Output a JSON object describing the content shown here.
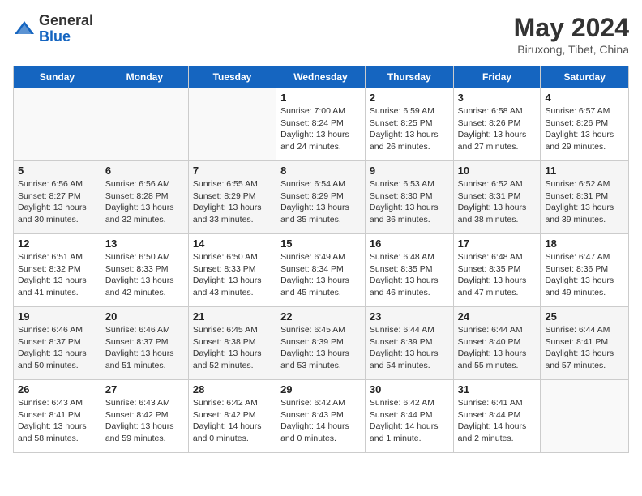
{
  "header": {
    "logo_general": "General",
    "logo_blue": "Blue",
    "month": "May 2024",
    "location": "Biruxong, Tibet, China"
  },
  "weekdays": [
    "Sunday",
    "Monday",
    "Tuesday",
    "Wednesday",
    "Thursday",
    "Friday",
    "Saturday"
  ],
  "weeks": [
    [
      {
        "day": "",
        "info": ""
      },
      {
        "day": "",
        "info": ""
      },
      {
        "day": "",
        "info": ""
      },
      {
        "day": "1",
        "info": "Sunrise: 7:00 AM\nSunset: 8:24 PM\nDaylight: 13 hours\nand 24 minutes."
      },
      {
        "day": "2",
        "info": "Sunrise: 6:59 AM\nSunset: 8:25 PM\nDaylight: 13 hours\nand 26 minutes."
      },
      {
        "day": "3",
        "info": "Sunrise: 6:58 AM\nSunset: 8:26 PM\nDaylight: 13 hours\nand 27 minutes."
      },
      {
        "day": "4",
        "info": "Sunrise: 6:57 AM\nSunset: 8:26 PM\nDaylight: 13 hours\nand 29 minutes."
      }
    ],
    [
      {
        "day": "5",
        "info": "Sunrise: 6:56 AM\nSunset: 8:27 PM\nDaylight: 13 hours\nand 30 minutes."
      },
      {
        "day": "6",
        "info": "Sunrise: 6:56 AM\nSunset: 8:28 PM\nDaylight: 13 hours\nand 32 minutes."
      },
      {
        "day": "7",
        "info": "Sunrise: 6:55 AM\nSunset: 8:29 PM\nDaylight: 13 hours\nand 33 minutes."
      },
      {
        "day": "8",
        "info": "Sunrise: 6:54 AM\nSunset: 8:29 PM\nDaylight: 13 hours\nand 35 minutes."
      },
      {
        "day": "9",
        "info": "Sunrise: 6:53 AM\nSunset: 8:30 PM\nDaylight: 13 hours\nand 36 minutes."
      },
      {
        "day": "10",
        "info": "Sunrise: 6:52 AM\nSunset: 8:31 PM\nDaylight: 13 hours\nand 38 minutes."
      },
      {
        "day": "11",
        "info": "Sunrise: 6:52 AM\nSunset: 8:31 PM\nDaylight: 13 hours\nand 39 minutes."
      }
    ],
    [
      {
        "day": "12",
        "info": "Sunrise: 6:51 AM\nSunset: 8:32 PM\nDaylight: 13 hours\nand 41 minutes."
      },
      {
        "day": "13",
        "info": "Sunrise: 6:50 AM\nSunset: 8:33 PM\nDaylight: 13 hours\nand 42 minutes."
      },
      {
        "day": "14",
        "info": "Sunrise: 6:50 AM\nSunset: 8:33 PM\nDaylight: 13 hours\nand 43 minutes."
      },
      {
        "day": "15",
        "info": "Sunrise: 6:49 AM\nSunset: 8:34 PM\nDaylight: 13 hours\nand 45 minutes."
      },
      {
        "day": "16",
        "info": "Sunrise: 6:48 AM\nSunset: 8:35 PM\nDaylight: 13 hours\nand 46 minutes."
      },
      {
        "day": "17",
        "info": "Sunrise: 6:48 AM\nSunset: 8:35 PM\nDaylight: 13 hours\nand 47 minutes."
      },
      {
        "day": "18",
        "info": "Sunrise: 6:47 AM\nSunset: 8:36 PM\nDaylight: 13 hours\nand 49 minutes."
      }
    ],
    [
      {
        "day": "19",
        "info": "Sunrise: 6:46 AM\nSunset: 8:37 PM\nDaylight: 13 hours\nand 50 minutes."
      },
      {
        "day": "20",
        "info": "Sunrise: 6:46 AM\nSunset: 8:37 PM\nDaylight: 13 hours\nand 51 minutes."
      },
      {
        "day": "21",
        "info": "Sunrise: 6:45 AM\nSunset: 8:38 PM\nDaylight: 13 hours\nand 52 minutes."
      },
      {
        "day": "22",
        "info": "Sunrise: 6:45 AM\nSunset: 8:39 PM\nDaylight: 13 hours\nand 53 minutes."
      },
      {
        "day": "23",
        "info": "Sunrise: 6:44 AM\nSunset: 8:39 PM\nDaylight: 13 hours\nand 54 minutes."
      },
      {
        "day": "24",
        "info": "Sunrise: 6:44 AM\nSunset: 8:40 PM\nDaylight: 13 hours\nand 55 minutes."
      },
      {
        "day": "25",
        "info": "Sunrise: 6:44 AM\nSunset: 8:41 PM\nDaylight: 13 hours\nand 57 minutes."
      }
    ],
    [
      {
        "day": "26",
        "info": "Sunrise: 6:43 AM\nSunset: 8:41 PM\nDaylight: 13 hours\nand 58 minutes."
      },
      {
        "day": "27",
        "info": "Sunrise: 6:43 AM\nSunset: 8:42 PM\nDaylight: 13 hours\nand 59 minutes."
      },
      {
        "day": "28",
        "info": "Sunrise: 6:42 AM\nSunset: 8:42 PM\nDaylight: 14 hours\nand 0 minutes."
      },
      {
        "day": "29",
        "info": "Sunrise: 6:42 AM\nSunset: 8:43 PM\nDaylight: 14 hours\nand 0 minutes."
      },
      {
        "day": "30",
        "info": "Sunrise: 6:42 AM\nSunset: 8:44 PM\nDaylight: 14 hours\nand 1 minute."
      },
      {
        "day": "31",
        "info": "Sunrise: 6:41 AM\nSunset: 8:44 PM\nDaylight: 14 hours\nand 2 minutes."
      },
      {
        "day": "",
        "info": ""
      }
    ]
  ]
}
